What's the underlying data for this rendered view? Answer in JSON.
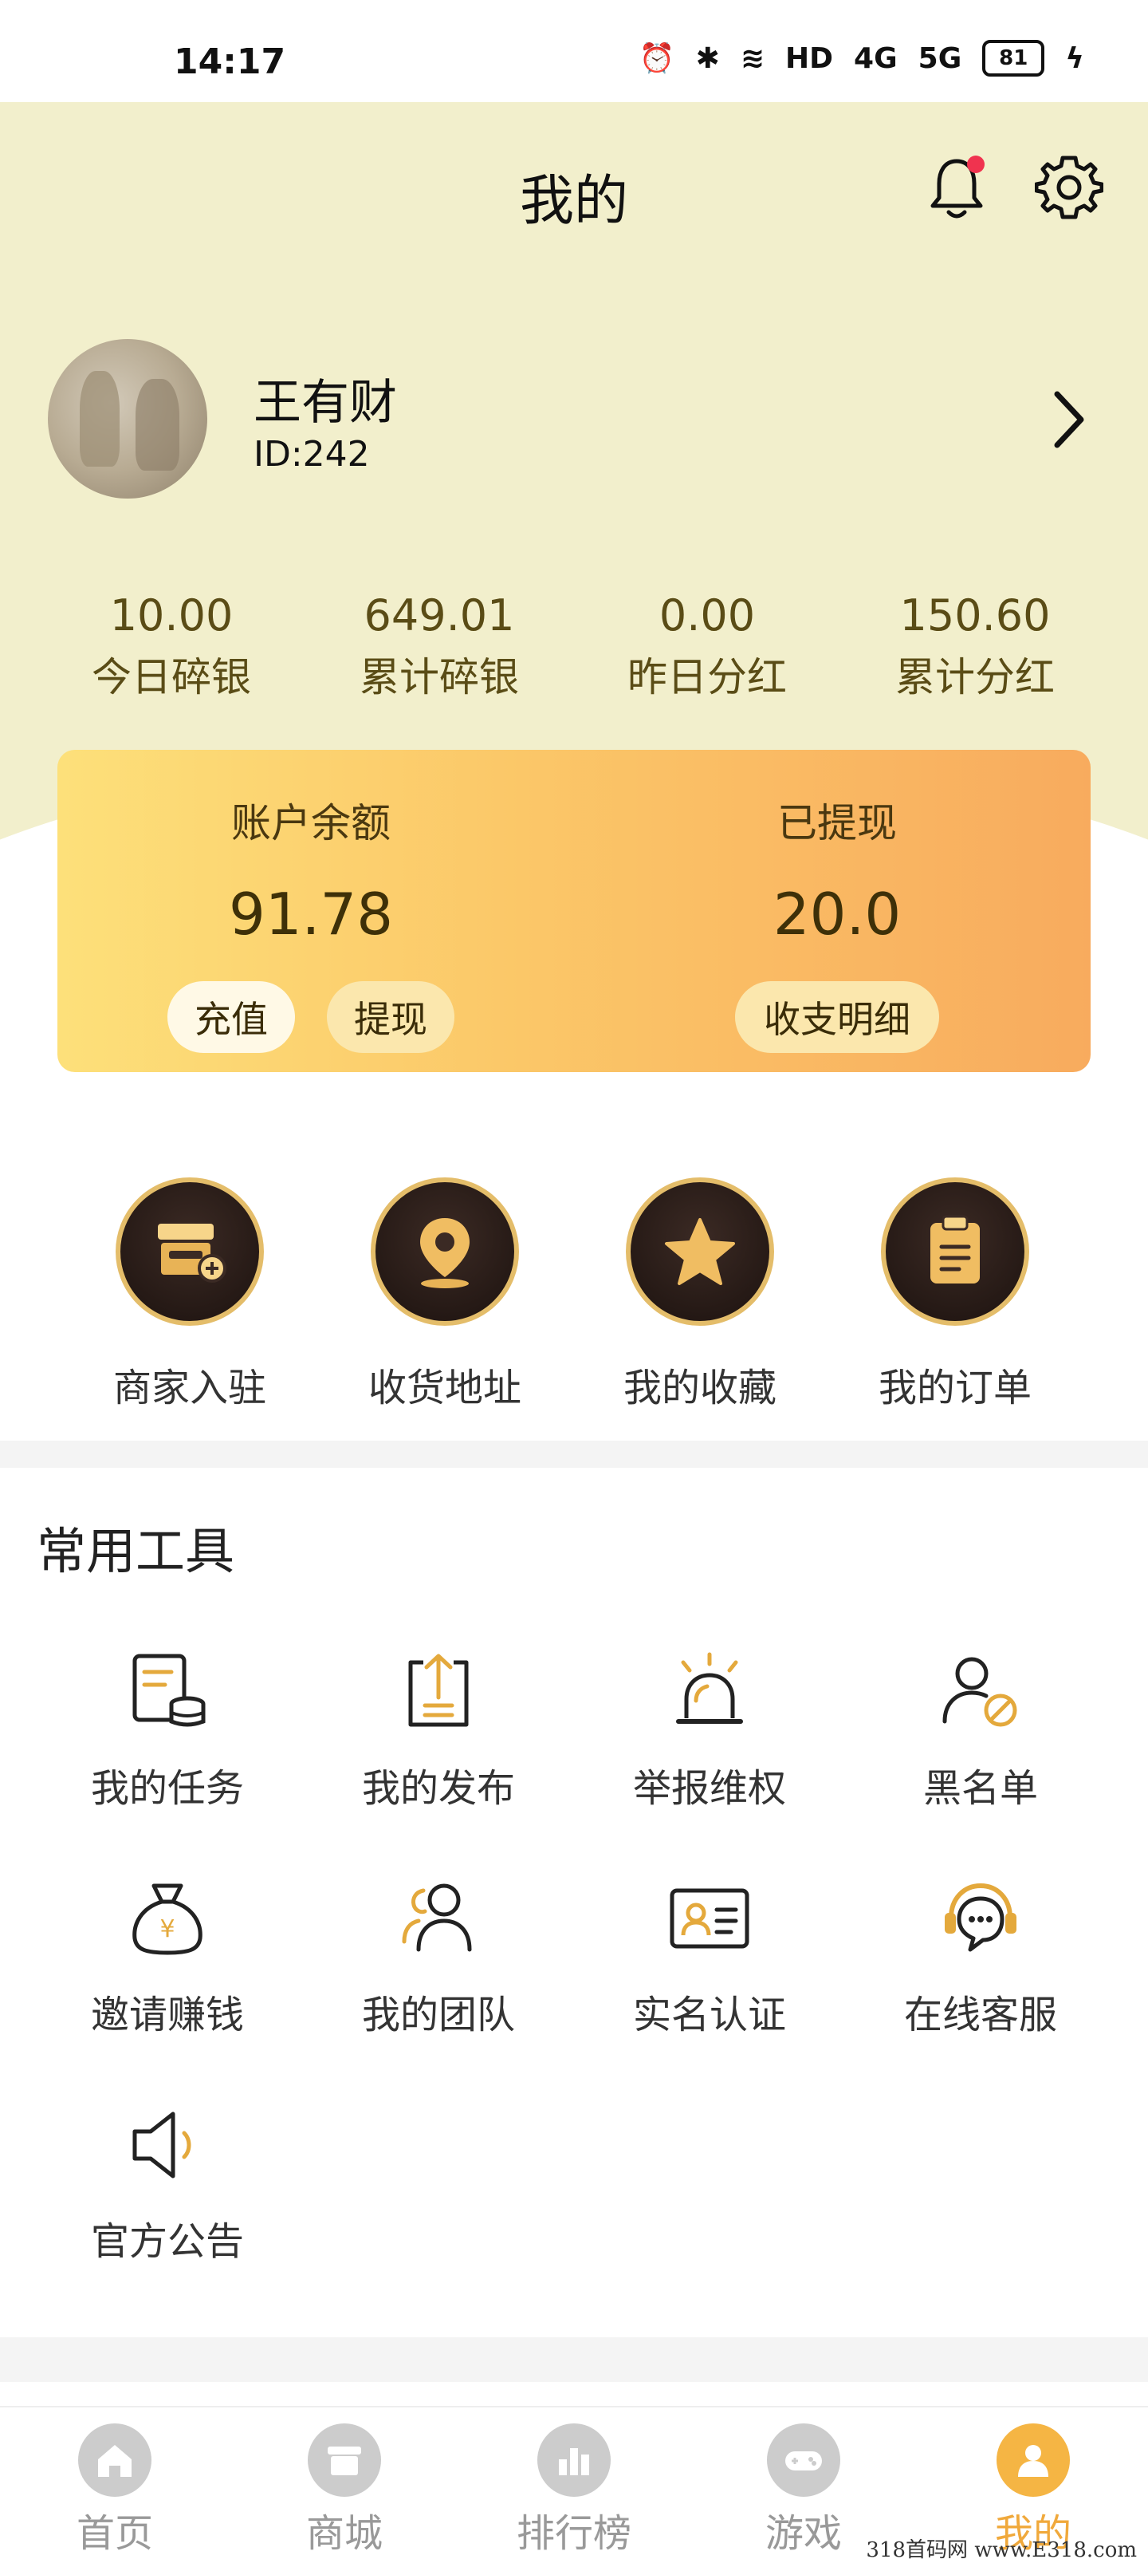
{
  "status_bar": {
    "time": "14:17",
    "signal_labels": [
      "HD",
      "4G",
      "5G"
    ],
    "battery": "81"
  },
  "header": {
    "title": "我的"
  },
  "profile": {
    "name": "王有财",
    "id": "ID:242"
  },
  "stats": [
    {
      "value": "10.00",
      "label": "今日碎银"
    },
    {
      "value": "649.01",
      "label": "累计碎银"
    },
    {
      "value": "0.00",
      "label": "昨日分红"
    },
    {
      "value": "150.60",
      "label": "累计分红"
    }
  ],
  "balance_card": {
    "balance_label": "账户余额",
    "balance_value": "91.78",
    "withdrawn_label": "已提现",
    "withdrawn_value": "20.0",
    "recharge_label": "充值",
    "withdraw_label": "提现",
    "details_label": "收支明细"
  },
  "quick_actions": [
    {
      "label": "商家入驻",
      "icon": "store-icon"
    },
    {
      "label": "收货地址",
      "icon": "location-icon"
    },
    {
      "label": "我的收藏",
      "icon": "star-icon"
    },
    {
      "label": "我的订单",
      "icon": "clipboard-icon"
    }
  ],
  "tools": {
    "title": "常用工具",
    "items": [
      {
        "label": "我的任务",
        "icon": "task-coins-icon"
      },
      {
        "label": "我的发布",
        "icon": "upload-icon"
      },
      {
        "label": "举报维权",
        "icon": "alarm-icon"
      },
      {
        "label": "黑名单",
        "icon": "user-block-icon"
      },
      {
        "label": "邀请赚钱",
        "icon": "money-bag-icon"
      },
      {
        "label": "我的团队",
        "icon": "team-icon"
      },
      {
        "label": "实名认证",
        "icon": "id-card-icon"
      },
      {
        "label": "在线客服",
        "icon": "headset-icon"
      },
      {
        "label": "官方公告",
        "icon": "speaker-icon"
      }
    ]
  },
  "bottom_nav": [
    {
      "label": "首页",
      "icon": "home-icon"
    },
    {
      "label": "商城",
      "icon": "shop-icon"
    },
    {
      "label": "排行榜",
      "icon": "ranking-icon"
    },
    {
      "label": "游戏",
      "icon": "gamepad-icon"
    },
    {
      "label": "我的",
      "icon": "user-icon",
      "active": true
    }
  ],
  "watermark": "318首码网 www.E318.com",
  "colors": {
    "accent": "#f0a93c",
    "icon_gold": "#e4a93c",
    "top_background": "#f2efcc"
  }
}
